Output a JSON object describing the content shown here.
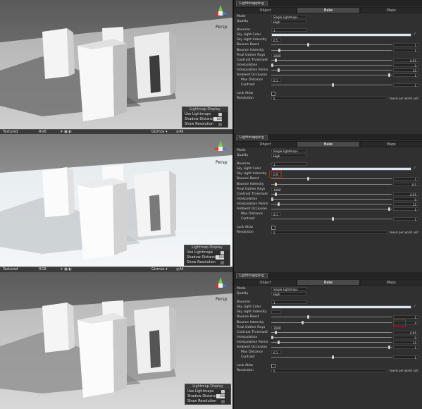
{
  "scene": {
    "persp_label": "Persp",
    "statusbar": {
      "left": "Textured",
      "mid": "RGB",
      "gizmos": "Gizmos ▾",
      "search": "◎All"
    },
    "overlay": {
      "title": "Lightmap Display",
      "use_lightmaps": "Use Lightmaps",
      "shadow_distance": "Shadow Distance",
      "shadow_distance_value": "100",
      "show_resolution": "Show Resolution"
    }
  },
  "inspector": {
    "window_title": "Lightmapping",
    "tabs": [
      "Object",
      "Bake",
      "Maps"
    ],
    "labels": {
      "mode": "Mode",
      "quality": "Quality",
      "bounces": "Bounces",
      "sky_light_color": "Sky Light Color",
      "sky_light_intensity": "Sky Light Intensity",
      "bounce_boost": "Bounce Boost",
      "bounce_intensity": "Bounce Intensity",
      "final_gather_rays": "Final Gather Rays",
      "contrast_threshold": "Contrast Threshold",
      "interpolation": "Interpolation",
      "interpolation_points": "Interpolation Points",
      "ambient_occlusion": "Ambient Occlusion",
      "max_distance": "Max Distance",
      "contrast": "Contrast",
      "lock_atlas": "Lock Atlas",
      "resolution": "Resolution",
      "texels_unit": "texels per world unit"
    },
    "mode_value": "Single Lightmaps"
  },
  "panels": [
    {
      "quality": "High",
      "bounces": "1",
      "sky_light_intensity": "0.5",
      "bounce_boost": "1",
      "bounce_intensity": "1",
      "final_gather_rays": "1000",
      "contrast_threshold": "0.05",
      "interpolation": "0",
      "interpolation_points": "15",
      "ambient_occlusion": "1",
      "max_distance": "0.1",
      "contrast": "1",
      "resolution": "5",
      "highlight": ""
    },
    {
      "quality": "High",
      "bounces": "1",
      "sky_light_intensity": "0.9",
      "bounce_boost": "1",
      "bounce_intensity": "0.5",
      "final_gather_rays": "1000",
      "contrast_threshold": "0.05",
      "interpolation": "0",
      "interpolation_points": "15",
      "ambient_occlusion": "1",
      "max_distance": "0.1",
      "contrast": "1",
      "resolution": "5",
      "highlight": "sky_light_intensity"
    },
    {
      "quality": "High",
      "bounces": "1",
      "sky_light_intensity": "",
      "bounce_boost": "1",
      "bounce_intensity": "4",
      "final_gather_rays": "1000",
      "contrast_threshold": "0.05",
      "interpolation": "0",
      "interpolation_points": "15",
      "ambient_occlusion": "1",
      "max_distance": "0.1",
      "contrast": "1",
      "resolution": "5",
      "highlight": "bounce_intensity"
    }
  ]
}
